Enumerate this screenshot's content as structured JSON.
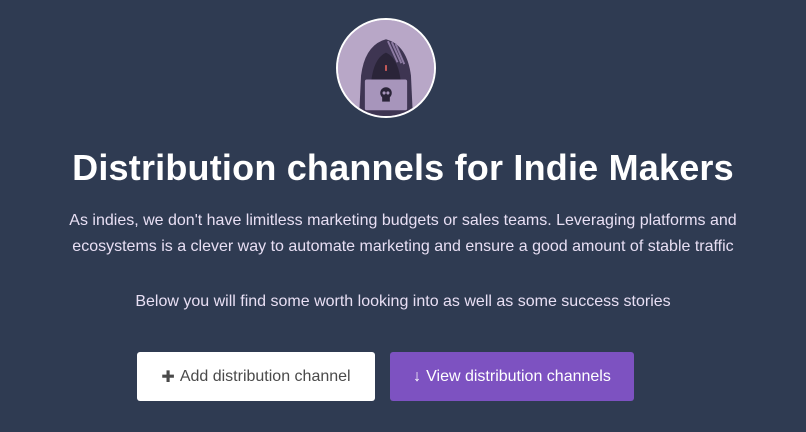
{
  "hero": {
    "title": "Distribution channels for Indie Makers",
    "description_line1": "As indies, we don't have limitless marketing budgets or sales teams. Leveraging platforms and",
    "description_line2": "ecosystems is a clever way to automate marketing and ensure a good amount of stable traffic",
    "note": "Below you will find some worth looking into as well as some success stories"
  },
  "actions": {
    "add_label": "Add distribution channel",
    "add_icon": "plus-icon",
    "view_label": "View distribution channels",
    "view_icon": "arrow-down-icon"
  },
  "colors": {
    "background": "#2f3b52",
    "primary": "#7d52c1",
    "text_light": "#e8dff4"
  }
}
